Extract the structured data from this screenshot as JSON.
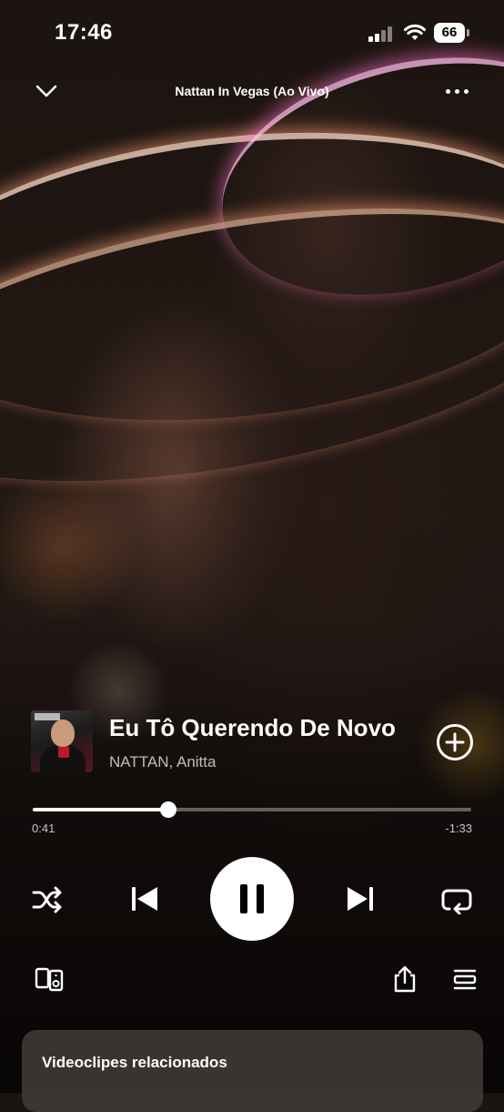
{
  "status_bar": {
    "time": "17:46",
    "battery": "66"
  },
  "top_bar": {
    "title": "Nattan In Vegas (Ao Vivo)"
  },
  "track": {
    "title": "Eu Tô Querendo De Novo",
    "artist": "NATTAN, Anitta"
  },
  "progress": {
    "elapsed": "0:41",
    "remaining": "-1:33",
    "fraction": 0.31
  },
  "playback": {
    "state": "playing"
  },
  "related": {
    "title": "Videoclipes relacionados"
  },
  "icons": {
    "collapse": "chevron-down-icon",
    "more": "more-options-icon",
    "add": "add-circle-icon",
    "shuffle": "shuffle-icon",
    "previous": "skip-previous-icon",
    "pause": "pause-icon",
    "next": "skip-next-icon",
    "repeat": "repeat-icon",
    "devices": "connect-device-icon",
    "share": "share-icon",
    "queue": "queue-icon"
  },
  "colors": {
    "accent": "#ffffff",
    "panel": "#3e3836"
  }
}
